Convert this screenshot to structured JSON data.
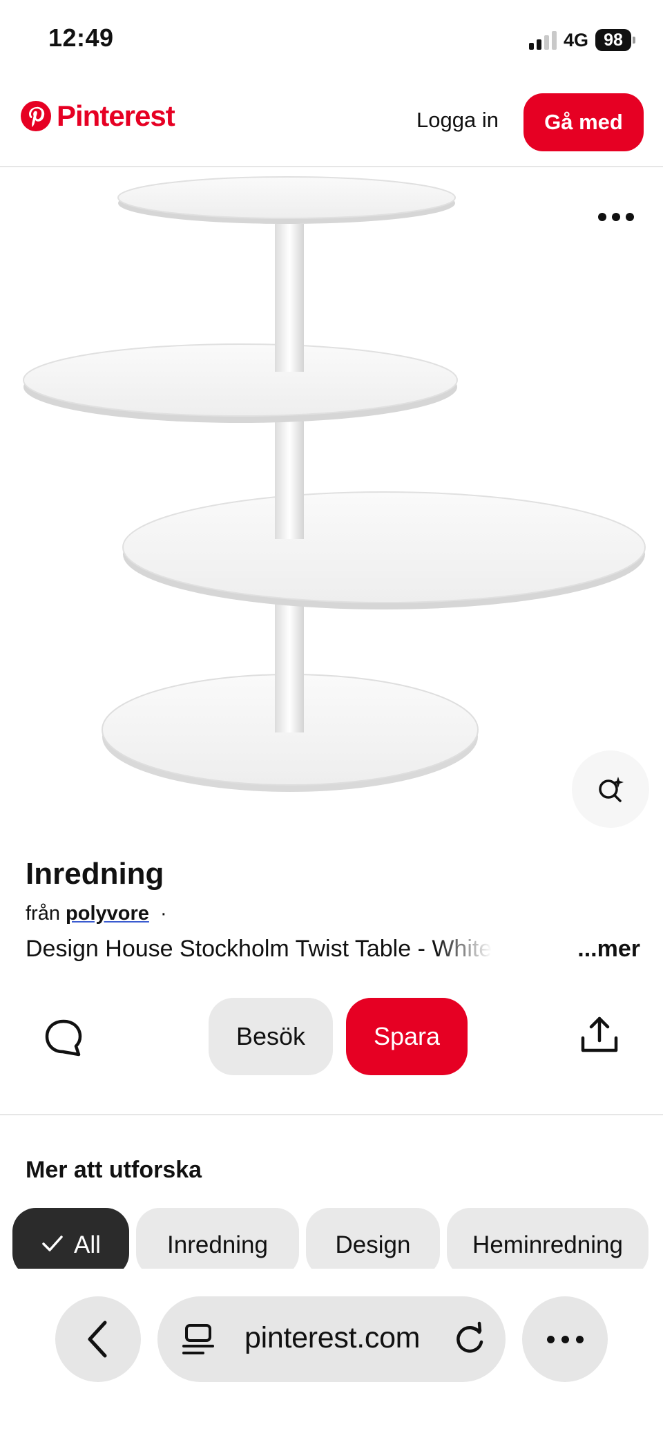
{
  "status_bar": {
    "time": "12:49",
    "network": "4G",
    "battery": "98"
  },
  "header": {
    "brand": "Pinterest",
    "login_label": "Logga in",
    "join_label": "Gå med",
    "accent_color": "#e60023"
  },
  "pin": {
    "image_subject": "white four-tier round table",
    "title": "Inredning",
    "source_prefix": "från",
    "source_name": "polyvore",
    "source_separator": "·",
    "description": "Design House Stockholm Twist Table - White",
    "more_label": "...mer"
  },
  "actions": {
    "comment_icon": "comment-icon",
    "visit_label": "Besök",
    "save_label": "Spara",
    "share_icon": "share-icon"
  },
  "explore": {
    "title": "Mer att utforska",
    "chips": [
      {
        "label": "All",
        "active": true
      },
      {
        "label": "Inredning",
        "active": false
      },
      {
        "label": "Design",
        "active": false
      },
      {
        "label": "Heminredning",
        "active": false
      }
    ]
  },
  "browser": {
    "url": "pinterest.com"
  }
}
